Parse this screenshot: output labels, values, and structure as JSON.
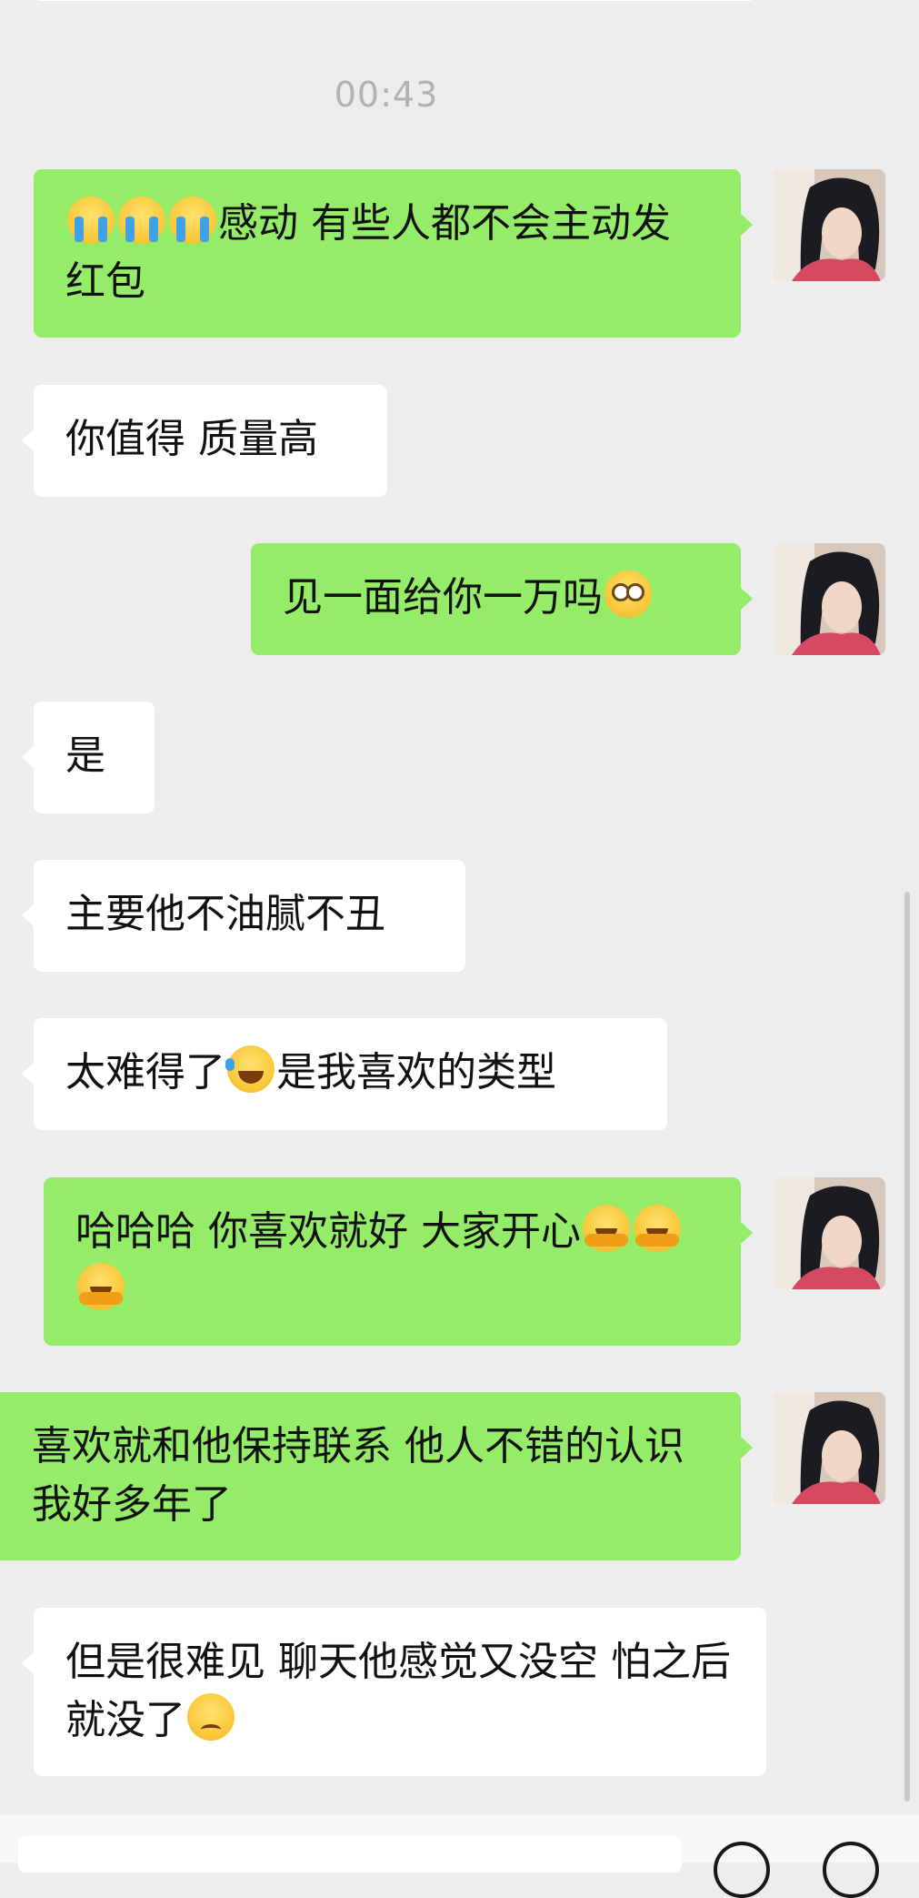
{
  "chat": {
    "timestamp": "00:43",
    "messages": [
      {
        "side": "out",
        "emoji_lead": [
          "crying-face-emoji",
          "crying-face-emoji",
          "crying-face-emoji"
        ],
        "text": "感动 有些人都不会主动发红包"
      },
      {
        "side": "in",
        "text": "你值得 质量高"
      },
      {
        "side": "out",
        "text": "见一面给你一万吗",
        "emoji_trail": [
          "thinking-face-emoji"
        ]
      },
      {
        "side": "in",
        "text": "是"
      },
      {
        "side": "in",
        "text": "主要他不油腻不丑"
      },
      {
        "side": "in",
        "text_a": "太难得了",
        "emoji_mid": "laughing-tears-emoji",
        "text_b": "是我喜欢的类型"
      },
      {
        "side": "out",
        "text": "哈哈哈 你喜欢就好 大家开心",
        "emoji_trail": [
          "hugging-face-emoji",
          "hugging-face-emoji",
          "hugging-face-emoji"
        ]
      },
      {
        "side": "out",
        "text": "喜欢就和他保持联系  他人不错的认识我好多年了"
      },
      {
        "side": "in",
        "text": "但是很难见 聊天他感觉又没空 怕之后就没了",
        "emoji_trail": [
          "disappointed-face-emoji"
        ]
      }
    ]
  },
  "colors": {
    "background": "#ededed",
    "outgoing_bubble": "#95ec69",
    "incoming_bubble": "#ffffff",
    "timestamp_text": "#b2b2b2"
  },
  "icons": {
    "avatar": "avatar-photo",
    "voice": "voice-icon",
    "emoji": "emoji-icon"
  }
}
